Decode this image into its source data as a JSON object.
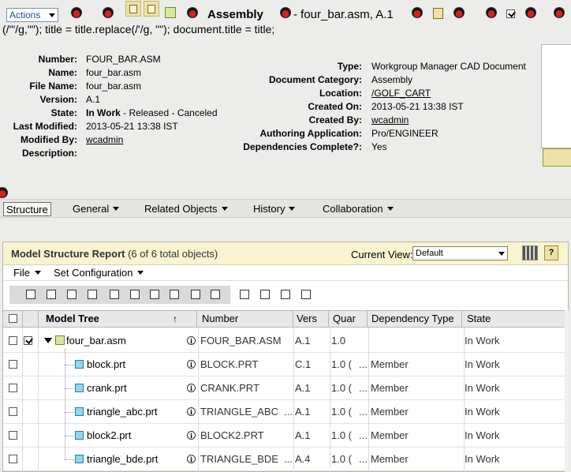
{
  "topbar": {
    "actions_label": "Actions",
    "title_bold": "Assembly",
    "title_rest": "- four_bar.asm, A.1"
  },
  "js_leak": "(/'\"/g,\"\"); title = title.replace(/'/g, \"\"); document.title = title;",
  "info_left": [
    {
      "label": "Number:",
      "value": "FOUR_BAR.ASM"
    },
    {
      "label": "Name:",
      "value": "four_bar.asm"
    },
    {
      "label": "File Name:",
      "value": "four_bar.asm"
    },
    {
      "label": "Version:",
      "value": "A.1"
    },
    {
      "label": "State:",
      "value": "In Work",
      "extra": "- Released - Canceled"
    },
    {
      "label": "Last Modified:",
      "value": "2013-05-21 13:38 IST"
    },
    {
      "label": "Modified By:",
      "value": "wcadmin"
    },
    {
      "label": "Description:",
      "value": ""
    }
  ],
  "info_right": [
    {
      "label": "Type:",
      "value": "Workgroup Manager CAD Document"
    },
    {
      "label": "Document Category:",
      "value": "Assembly"
    },
    {
      "label": "Location:",
      "value": "/GOLF_CART"
    },
    {
      "label": "Created On:",
      "value": "2013-05-21 13:38 IST"
    },
    {
      "label": "Created By:",
      "value": "wcadmin"
    },
    {
      "label": "Authoring Application:",
      "value": "Pro/ENGINEER"
    },
    {
      "label": "Dependencies Complete?:",
      "value": "Yes"
    }
  ],
  "tabs": [
    {
      "label": "Structure"
    },
    {
      "label": "General"
    },
    {
      "label": "Related Objects"
    },
    {
      "label": "History"
    },
    {
      "label": "Collaboration"
    }
  ],
  "report": {
    "title": "Model Structure Report",
    "count": "(6 of 6 total objects)",
    "current_view_label": "Current View:",
    "current_view_value": "Default",
    "help_label": "?"
  },
  "menus": [
    {
      "label": "File"
    },
    {
      "label": "Set Configuration"
    }
  ],
  "table": {
    "columns": [
      "Model Tree",
      "↑",
      "Number",
      "Vers",
      "Quar",
      "Dependency Type",
      "State"
    ],
    "rows": [
      {
        "name": "four_bar.asm",
        "number": "FOUR_BAR.ASM",
        "version": "A.1",
        "quantity": "1.0",
        "dependency": "",
        "state": "In Work",
        "checked": true
      },
      {
        "name": "block.prt",
        "number": "BLOCK.PRT",
        "version": "C.1",
        "quantity": "1.0 (",
        "dependency": "Member",
        "state": "In Work",
        "checked": false
      },
      {
        "name": "crank.prt",
        "number": "CRANK.PRT",
        "version": "A.1",
        "quantity": "1.0 (",
        "dependency": "Member",
        "state": "In Work",
        "checked": false
      },
      {
        "name": "triangle_abc.prt",
        "number": "TRIANGLE_ABC",
        "version": "A.1",
        "quantity": "1.0 (",
        "dependency": "Member",
        "state": "In Work",
        "checked": false
      },
      {
        "name": "block2.prt",
        "number": "BLOCK2.PRT",
        "version": "A.1",
        "quantity": "1.0 (",
        "dependency": "Member",
        "state": "In Work",
        "checked": false
      },
      {
        "name": "triangle_bde.prt",
        "number": "TRIANGLE_BDE",
        "version": "A.4",
        "quantity": "1.0 (",
        "dependency": "Member",
        "state": "In Work",
        "checked": false
      }
    ]
  },
  "ellipsis": "..."
}
